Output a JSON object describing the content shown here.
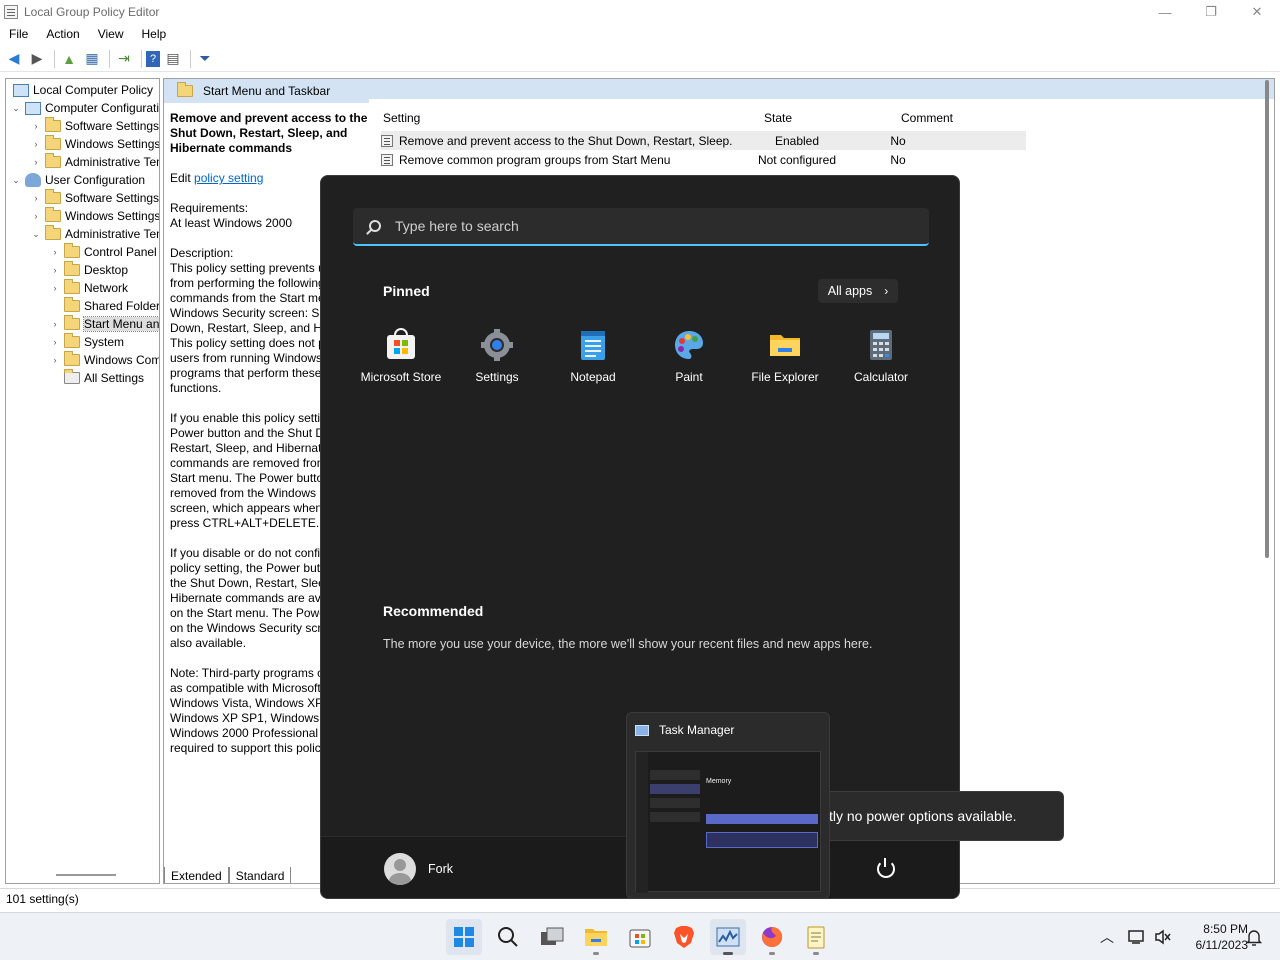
{
  "window": {
    "title": "Local Group Policy Editor",
    "controls": [
      "—",
      "❐",
      "✕"
    ]
  },
  "menu": [
    "File",
    "Action",
    "View",
    "Help"
  ],
  "tree": [
    {
      "label": "Local Computer Policy",
      "icon": "computer-icon",
      "exp": ""
    },
    {
      "label": "Computer Configuration",
      "icon": "computer-icon",
      "exp": "⌄"
    },
    {
      "label": "Software Settings",
      "icon": "folder-icon",
      "exp": "›"
    },
    {
      "label": "Windows Settings",
      "icon": "folder-icon",
      "exp": "›"
    },
    {
      "label": "Administrative Templates",
      "icon": "folder-icon",
      "exp": "›"
    },
    {
      "label": "User Configuration",
      "icon": "user-icon",
      "exp": "⌄"
    },
    {
      "label": "Software Settings",
      "icon": "folder-icon",
      "exp": "›"
    },
    {
      "label": "Windows Settings",
      "icon": "folder-icon",
      "exp": "›"
    },
    {
      "label": "Administrative Templates",
      "icon": "folder-icon",
      "exp": "⌄"
    },
    {
      "label": "Control Panel",
      "icon": "folder-icon",
      "exp": "›"
    },
    {
      "label": "Desktop",
      "icon": "folder-icon",
      "exp": "›"
    },
    {
      "label": "Network",
      "icon": "folder-icon",
      "exp": "›"
    },
    {
      "label": "Shared Folders",
      "icon": "folder-icon",
      "exp": ""
    },
    {
      "label": "Start Menu and Taskbar",
      "icon": "folder-icon",
      "exp": "›"
    },
    {
      "label": "System",
      "icon": "folder-icon",
      "exp": "›"
    },
    {
      "label": "Windows Components",
      "icon": "folder-icon",
      "exp": "›"
    },
    {
      "label": "All Settings",
      "icon": "settings-list-icon",
      "exp": ""
    }
  ],
  "pane": {
    "header": "Start Menu and Taskbar",
    "heading": "Remove and prevent access to the Shut Down, Restart, Sleep, and Hibernate commands",
    "edit_prefix": "Edit ",
    "edit_link": "policy setting",
    "requirements_label": "Requirements:",
    "requirements": "At least Windows 2000",
    "description_label": "Description:",
    "desc1": "This policy setting prevents users from performing the following commands from the Start menu or Windows Security screen: Shut Down, Restart, Sleep, and Hibernate. This policy setting does not prevent users from running Windows-based programs that perform these functions.",
    "desc2": "If you enable this policy setting, the Power button and the Shut Down, Restart, Sleep, and Hibernate commands are removed from the Start menu. The Power button is also removed from the Windows Security screen, which appears when you press CTRL+ALT+DELETE.",
    "desc3": "If you disable or do not configure this policy setting, the Power button and the Shut Down, Restart, Sleep, and Hibernate commands are available on the Start menu. The Power button on the Windows Security screen is also available.",
    "desc4": "Note: Third-party programs certified as compatible with Microsoft Windows Vista, Windows XP SP2, Windows XP SP1, Windows XP, or Windows 2000 Professional are required to support this policy setting."
  },
  "list": {
    "columns": {
      "setting": "Setting",
      "state": "State",
      "comment": "Comment"
    },
    "rows": [
      {
        "setting": "Remove and prevent access to the Shut Down, Restart, Sleep...",
        "state": "Enabled",
        "comment": "No"
      },
      {
        "setting": "Remove common program groups from Start Menu",
        "state": "Not configured",
        "comment": "No"
      }
    ]
  },
  "tabs": [
    "Extended",
    "Standard"
  ],
  "status": "101 setting(s)",
  "start_menu": {
    "search_placeholder": "Type here to search",
    "pinned_title": "Pinned",
    "all_apps": "All apps",
    "apps": [
      {
        "label": "Microsoft Store",
        "icon": "store-icon"
      },
      {
        "label": "Settings",
        "icon": "gear-icon"
      },
      {
        "label": "Notepad",
        "icon": "notepad-icon"
      },
      {
        "label": "Paint",
        "icon": "paint-icon"
      },
      {
        "label": "File Explorer",
        "icon": "folder-icon"
      },
      {
        "label": "Calculator",
        "icon": "calculator-icon"
      }
    ],
    "recommended_title": "Recommended",
    "recommended_text": "The more you use your device, the more we'll show your recent files and new apps here.",
    "user_name": "Fork"
  },
  "toast": {
    "text": "tly no power options available."
  },
  "task_manager_preview": {
    "title": "Task Manager",
    "thumb_heading": "Memory"
  },
  "taskbar": {
    "icons": [
      "start-icon",
      "search-icon",
      "task-view-icon",
      "file-explorer-icon",
      "store-icon",
      "brave-icon",
      "task-manager-icon",
      "firefox-icon",
      "notepad-icon"
    ],
    "time": "8:50 PM",
    "date": "6/11/2023"
  },
  "colors": {
    "accent": "#4cc2ff",
    "start_bg": "#202020",
    "header_bg": "#d3e3f3"
  }
}
